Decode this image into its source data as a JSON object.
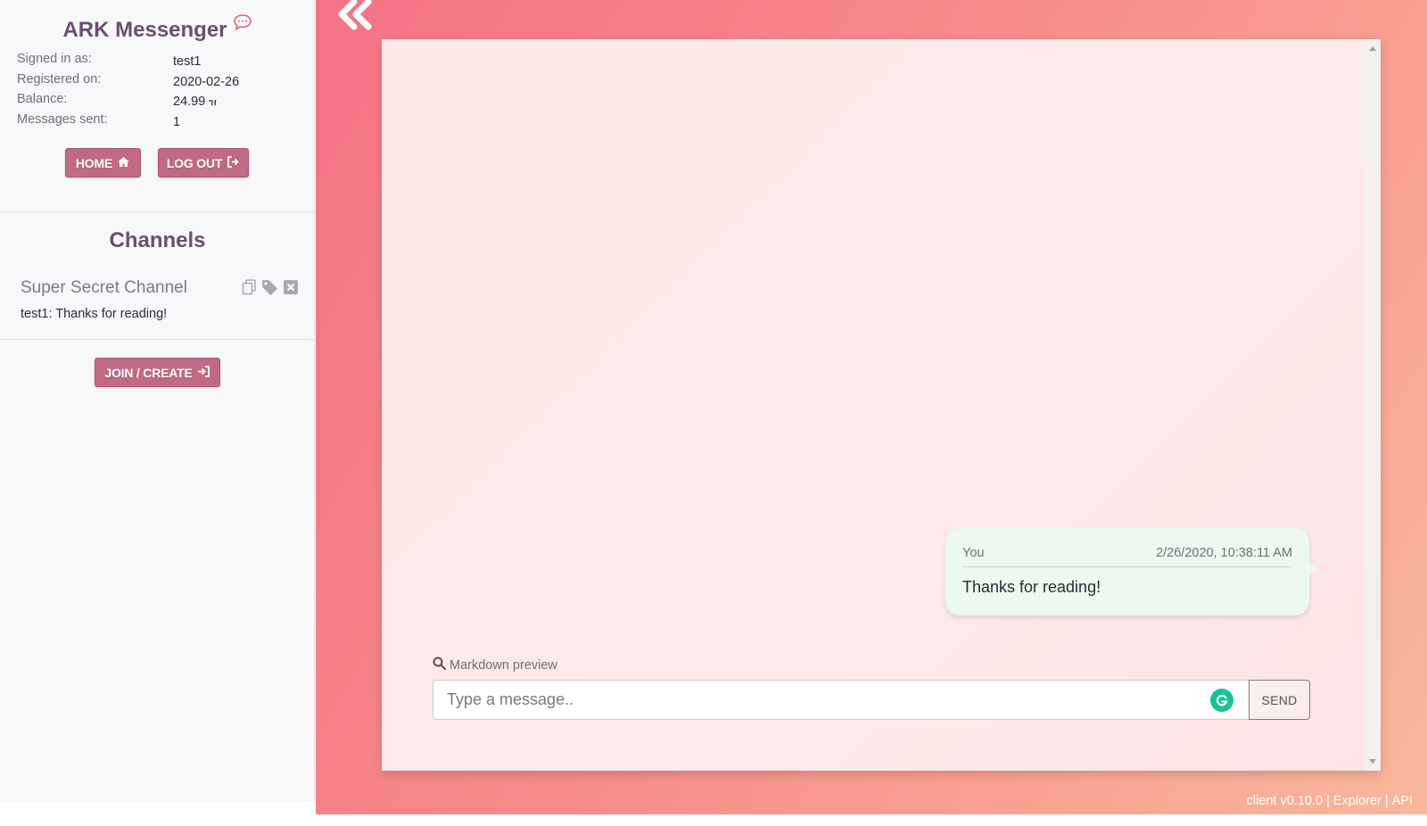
{
  "sidebar": {
    "app_title": "ARK Messenger",
    "info": [
      {
        "label": "Signed in as:",
        "value": "test1"
      },
      {
        "label": "Registered on:",
        "value": "2020-02-26"
      },
      {
        "label": "Balance:",
        "value": "24.99",
        "currency_symbol": "ዝ"
      },
      {
        "label": "Messages sent:",
        "value": "1"
      }
    ],
    "buttons": {
      "home": "HOME",
      "logout": "LOG OUT",
      "join_create": "JOIN / CREATE"
    },
    "channels_title": "Channels",
    "channels": [
      {
        "name": "Super Secret Channel",
        "last_sender": "test1",
        "last_message": ": Thanks for reading!"
      }
    ]
  },
  "chat": {
    "messages": [
      {
        "author": "You",
        "timestamp": "2/26/2020, 10:38:11 AM",
        "text": "Thanks for reading!"
      }
    ],
    "markdown_preview_label": "Markdown preview",
    "input_placeholder": "Type a message..",
    "send_label": "SEND"
  },
  "footer": {
    "version": "client v0.10.0",
    "sep": "|",
    "explorer": "Explorer",
    "api": "API"
  },
  "colors": {
    "accent_button": "#c06a84",
    "title": "#6a4f6e",
    "bubble": "#ebf9ef",
    "grammarly": "#15c39a"
  },
  "icons": [
    "chat-bubble-icon",
    "home-icon",
    "sign-out-icon",
    "copy-icon",
    "tag-icon",
    "close-square-icon",
    "sign-in-icon",
    "search-icon",
    "grammarly-icon",
    "double-chevron-left-icon"
  ]
}
